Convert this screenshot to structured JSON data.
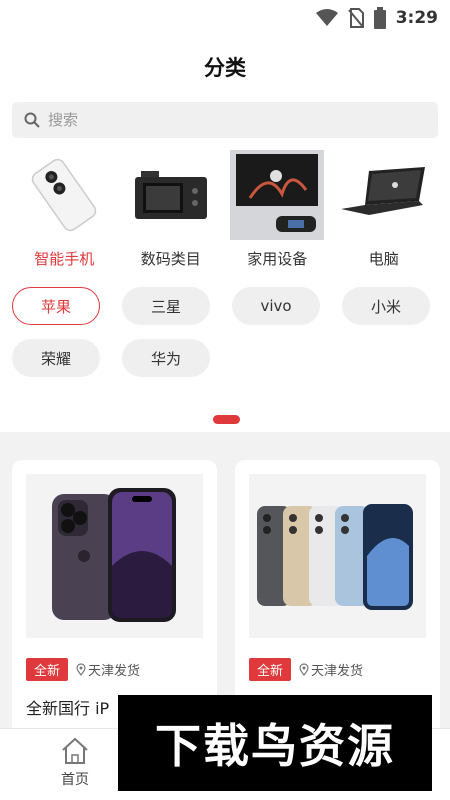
{
  "status": {
    "time": "3:29",
    "icons": [
      "wifi-icon",
      "no-sim-icon",
      "battery-icon"
    ]
  },
  "header": {
    "title": "分类"
  },
  "search": {
    "placeholder": "搜索"
  },
  "categories": [
    {
      "label": "智能手机",
      "icon": "phone-image",
      "active": true
    },
    {
      "label": "数码类目",
      "icon": "camera-image",
      "active": false
    },
    {
      "label": "家用设备",
      "icon": "tv-image",
      "active": false
    },
    {
      "label": "电脑",
      "icon": "laptop-image",
      "active": false
    }
  ],
  "brands": [
    {
      "label": "苹果",
      "active": true
    },
    {
      "label": "三星",
      "active": false
    },
    {
      "label": "vivo",
      "active": false
    },
    {
      "label": "小米",
      "active": false
    },
    {
      "label": "荣耀",
      "active": false
    },
    {
      "label": "华为",
      "active": false
    }
  ],
  "products": [
    {
      "badge": "全新",
      "shipping": "天津发货",
      "name": "全新国行 iP"
    },
    {
      "badge": "全新",
      "shipping": "天津发货",
      "name": ""
    }
  ],
  "tabbar": {
    "home_label": "首页"
  },
  "watermark": {
    "text": "下载鸟资源"
  },
  "colors": {
    "accent": "#e0393b",
    "background": "#ffffff",
    "chip": "#efefef"
  }
}
